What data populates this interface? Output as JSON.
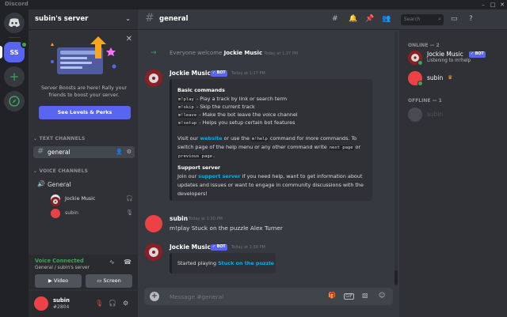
{
  "app": {
    "title": "Discord",
    "window_controls": [
      "–",
      "□",
      "✕"
    ]
  },
  "server": {
    "icon_label": "SS",
    "name": "subin's server"
  },
  "boost_banner": {
    "text": "Server Boosts are here! Rally your friends to boost your server.",
    "button": "See Levels & Perks"
  },
  "categories": {
    "text": "TEXT CHANNELS",
    "voice": "VOICE CHANNELS"
  },
  "text_channel": {
    "name": "general"
  },
  "voice_channel": {
    "name": "General",
    "users": [
      {
        "name": "Jockie Music"
      },
      {
        "name": "subin"
      }
    ]
  },
  "voice_status": {
    "title": "Voice Connected",
    "location": "General / subin's server",
    "video": "Video",
    "screen": "Screen"
  },
  "user": {
    "name": "subin",
    "tag": "#2804"
  },
  "header": {
    "channel": "general",
    "search_placeholder": "Search"
  },
  "messages": {
    "system": {
      "text": "Everyone welcome",
      "user": "Jockie Music",
      "time": "Today at 1:27 PM"
    },
    "bot1": {
      "user": "Jockie Music",
      "badge": "BOT",
      "time": "Today at 1:27 PM",
      "heading": "Basic commands",
      "commands": [
        {
          "cmd": "m!play",
          "desc": " - Play a track by link or search term"
        },
        {
          "cmd": "m!skip",
          "desc": " - Skip the current track"
        },
        {
          "cmd": "m!leave",
          "desc": " - Make the bot leave the voice channel"
        },
        {
          "cmd": "m!setup",
          "desc": " - Helps you setup certain bot features"
        }
      ],
      "visit_1": "Visit our ",
      "website": "website",
      "visit_2": " or use the ",
      "help_cmd": "m!help",
      "visit_3": " command for more commands. To",
      "switch_1": "switch page of the help menu or any other command write ",
      "next_page": "next page",
      "switch_2": " or",
      "prev_page": "previous page",
      "period": ".",
      "support_heading": "Support server",
      "join_1": "Join our ",
      "support_link": "support server",
      "join_2": " if you need help, want to get information about",
      "join_line2": "updates and issues or want to engage in community discussions with the",
      "join_line3": "developers!"
    },
    "user_msg": {
      "user": "subin",
      "time": "Today at 1:30 PM",
      "text": "m!play Stuck on the puzzle Alex Turner"
    },
    "bot2": {
      "user": "Jockie Music",
      "badge": "BOT",
      "time": "Today at 1:30 PM",
      "started": "Started playing ",
      "track": "Stuck on the puzzle"
    }
  },
  "composer": {
    "placeholder": "Message #general",
    "gif": "GIF"
  },
  "members": {
    "online_header": "ONLINE — 2",
    "offline_header": "OFFLINE — 1",
    "online": [
      {
        "name": "Jockie Music",
        "badge": "BOT",
        "status": "Listening to m!help"
      },
      {
        "name": "subin",
        "crown": "♛"
      }
    ],
    "offline": [
      {
        "name": "subin"
      }
    ]
  },
  "colors": {
    "blurple": "#5865f2",
    "green": "#3ba55d",
    "red": "#ed4245",
    "link": "#00aff4"
  }
}
